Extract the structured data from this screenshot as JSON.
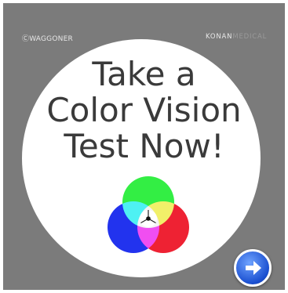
{
  "header": {
    "copyright": "ⒸWAGGONER",
    "brand_primary": "KONAN",
    "brand_secondary": "MEDICAL"
  },
  "main": {
    "headline_lines": [
      "Take a",
      "Color Vision",
      "Test Now!"
    ]
  },
  "colors": {
    "background": "#7b7b7b",
    "disc": "#ffffff",
    "headline": "#3a3a3a",
    "green": "#33ee44",
    "blue": "#2233ee",
    "red": "#ee2233",
    "button": "#1a4fd0"
  },
  "icons": {
    "venn": "rgb-venn-icon",
    "next": "right-arrow-icon"
  }
}
